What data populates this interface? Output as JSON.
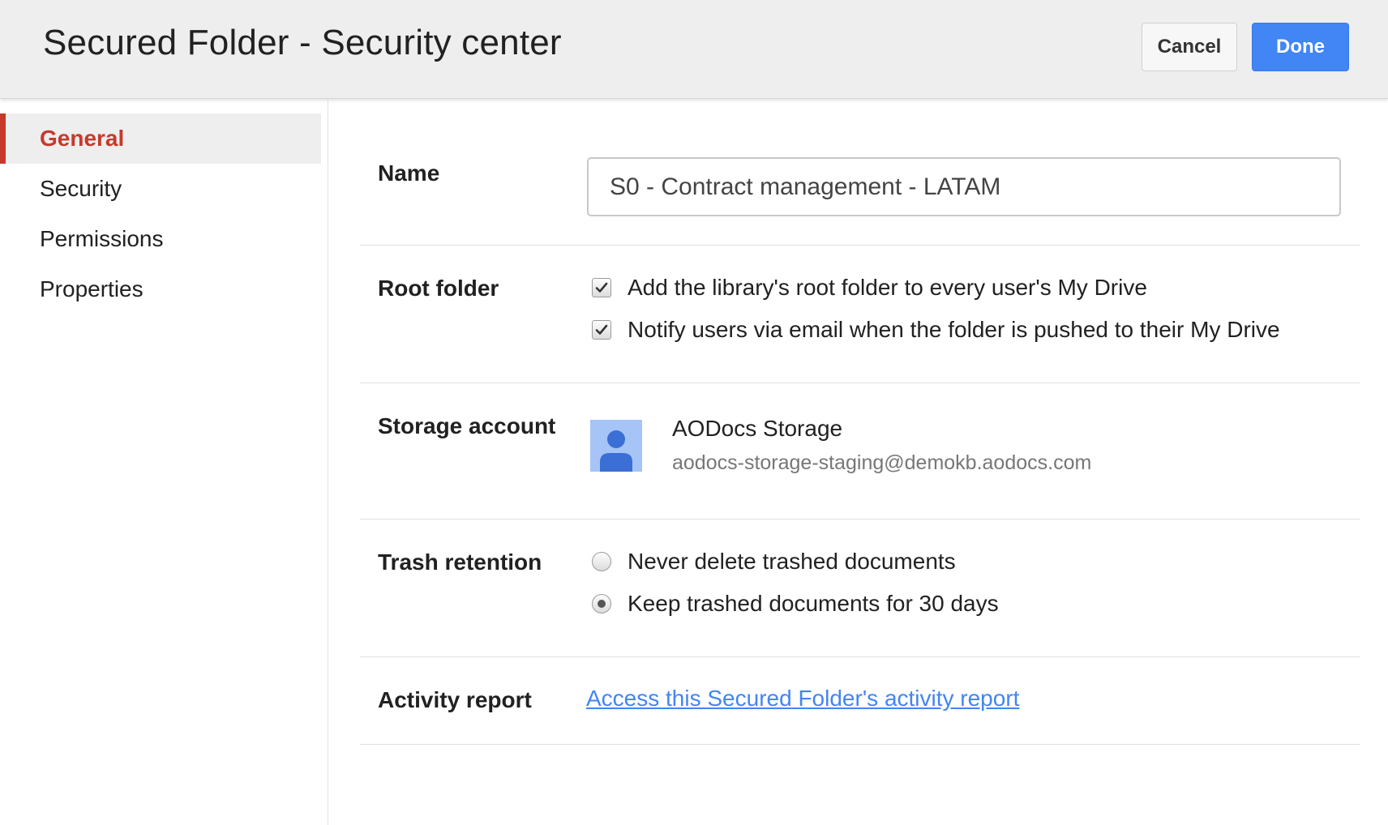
{
  "header": {
    "title": "Secured Folder - Security center",
    "cancel_label": "Cancel",
    "done_label": "Done"
  },
  "sidebar": {
    "items": [
      {
        "label": "General",
        "active": true
      },
      {
        "label": "Security",
        "active": false
      },
      {
        "label": "Permissions",
        "active": false
      },
      {
        "label": "Properties",
        "active": false
      }
    ]
  },
  "general": {
    "name": {
      "label": "Name",
      "value": "S0 - Contract management - LATAM"
    },
    "root_folder": {
      "label": "Root folder",
      "options": [
        {
          "text": "Add the library's root folder to every user's My Drive",
          "checked": true
        },
        {
          "text": "Notify users via email when the folder is pushed to their My Drive",
          "checked": true
        }
      ]
    },
    "storage_account": {
      "label": "Storage account",
      "name": "AODocs Storage",
      "email": "aodocs-storage-staging@demokb.aodocs.com",
      "avatar_icon": "person-icon"
    },
    "trash_retention": {
      "label": "Trash retention",
      "options": [
        {
          "text": "Never delete trashed documents",
          "selected": false
        },
        {
          "text": "Keep trashed documents for 30 days",
          "selected": true
        }
      ]
    },
    "activity_report": {
      "label": "Activity report",
      "link_text": "Access this Secured Folder's activity report"
    }
  },
  "colors": {
    "accent_red": "#c8392b",
    "primary_blue": "#4285f4",
    "header_bg": "#eeeeee"
  }
}
